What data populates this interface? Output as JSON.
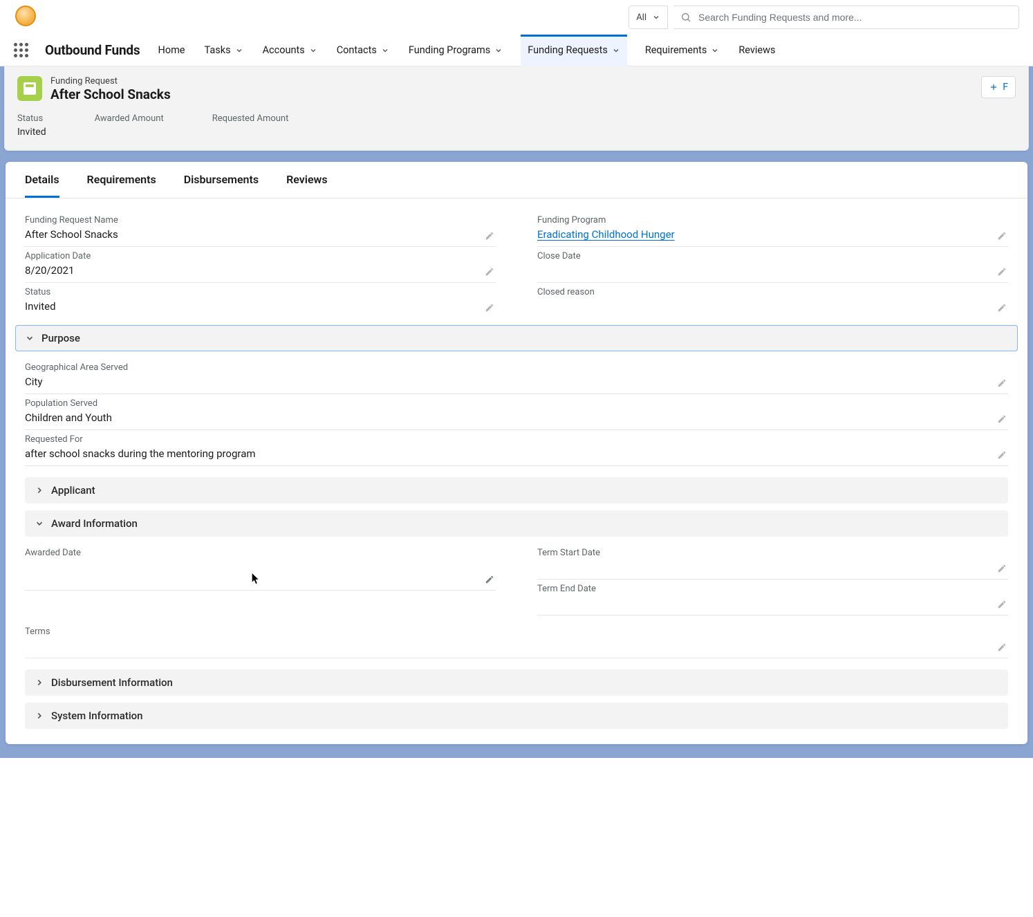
{
  "search": {
    "scope": "All",
    "placeholder": "Search Funding Requests and more..."
  },
  "appName": "Outbound Funds",
  "nav": {
    "home": "Home",
    "tasks": "Tasks",
    "accounts": "Accounts",
    "contacts": "Contacts",
    "programs": "Funding Programs",
    "requests": "Funding Requests",
    "requirements": "Requirements",
    "reviews": "Reviews"
  },
  "header": {
    "type": "Funding Request",
    "title": "After School Snacks",
    "action": "F",
    "kv": {
      "status_label": "Status",
      "status_value": "Invited",
      "awarded_label": "Awarded Amount",
      "awarded_value": "",
      "requested_label": "Requested Amount",
      "requested_value": ""
    }
  },
  "tabs": {
    "details": "Details",
    "requirements": "Requirements",
    "disbursements": "Disbursements",
    "reviews": "Reviews"
  },
  "fields": {
    "name_label": "Funding Request Name",
    "name_value": "After School Snacks",
    "program_label": "Funding Program",
    "program_value": "Eradicating Childhood Hunger",
    "appdate_label": "Application Date",
    "appdate_value": "8/20/2021",
    "closedate_label": "Close Date",
    "closedate_value": "",
    "status_label": "Status",
    "status_value": "Invited",
    "closedreason_label": "Closed reason",
    "closedreason_value": ""
  },
  "sections": {
    "purpose": "Purpose",
    "applicant": "Applicant",
    "award": "Award Information",
    "disbursement": "Disbursement Information",
    "system": "System Information"
  },
  "purpose": {
    "geo_label": "Geographical Area Served",
    "geo_value": "City",
    "pop_label": "Population Served",
    "pop_value": "Children and Youth",
    "reqfor_label": "Requested For",
    "reqfor_value": "after school snacks during the mentoring program"
  },
  "award": {
    "awarded_date_label": "Awarded Date",
    "awarded_date_value": "",
    "term_start_label": "Term Start Date",
    "term_start_value": "",
    "term_end_label": "Term End Date",
    "term_end_value": "",
    "terms_label": "Terms",
    "terms_value": ""
  }
}
